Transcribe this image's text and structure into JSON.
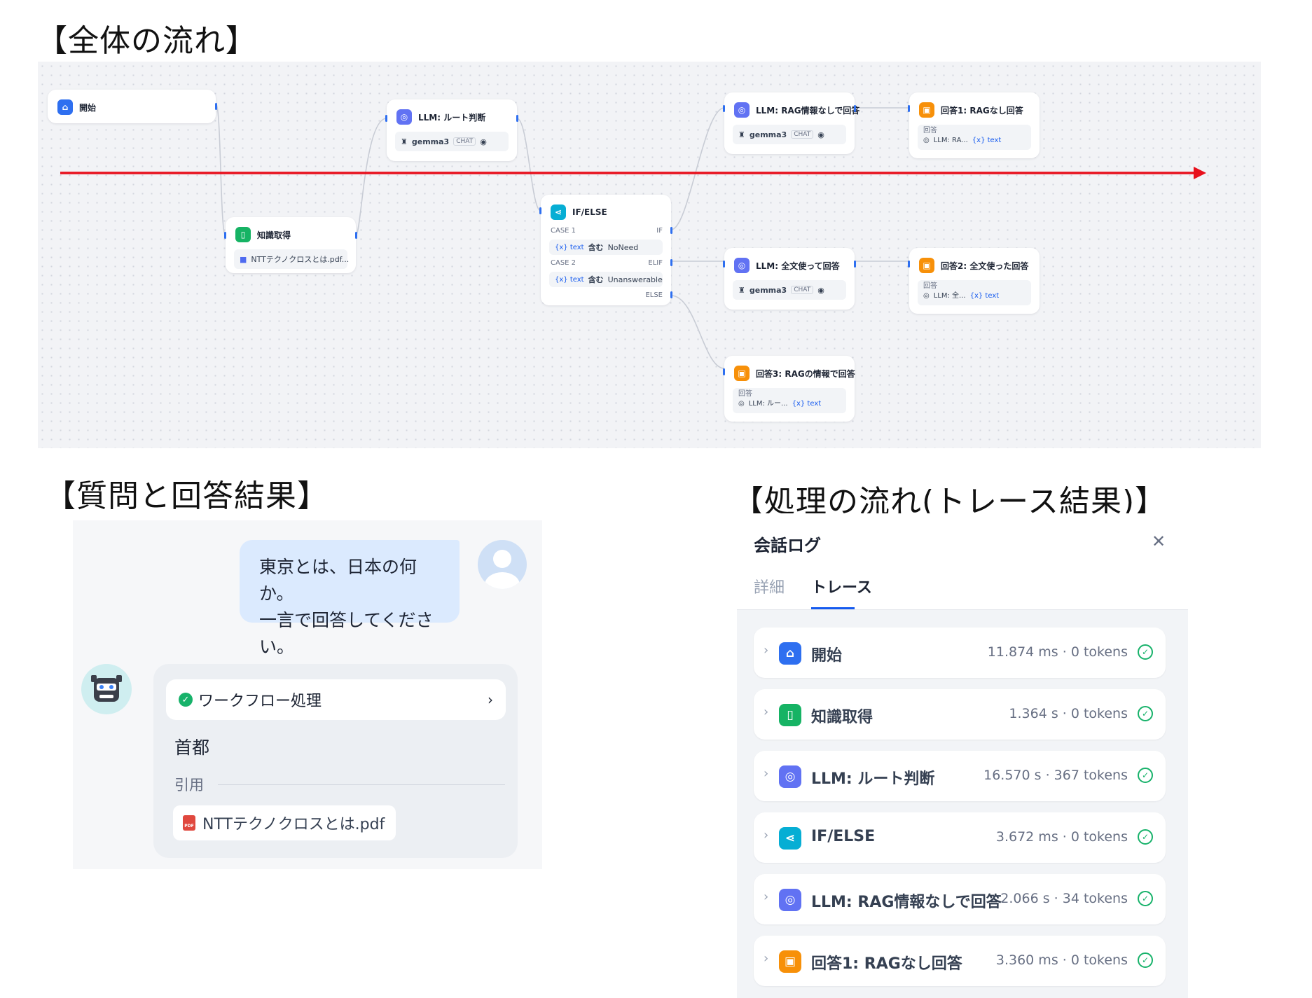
{
  "headings": {
    "overall_flow": "【全体の流れ】",
    "qa_result": "【質問と回答結果】",
    "process_flow": "【処理の流れ(トレース結果)】"
  },
  "workflow": {
    "start": {
      "title": "開始",
      "icon": "home-icon"
    },
    "knowledge": {
      "title": "知識取得",
      "file": "NTTテクノクロスとは.pdf...",
      "icon": "book-icon"
    },
    "llm_route": {
      "title": "LLM: ルート判断",
      "model": "gemma3",
      "tag": "CHAT"
    },
    "ifelse": {
      "title": "IF/ELSE",
      "case1": "CASE 1",
      "if": "IF",
      "cond1_var": "{x} text",
      "cond1_op": "含む",
      "cond1_val": "NoNeed",
      "case2": "CASE 2",
      "elif": "ELIF",
      "cond2_var": "{x} text",
      "cond2_op": "含む",
      "cond2_val": "Unanswerable",
      "else": "ELSE"
    },
    "llm_norag": {
      "title": "LLM: RAG情報なしで回答",
      "model": "gemma3",
      "tag": "CHAT"
    },
    "llm_full": {
      "title": "LLM: 全文使って回答",
      "model": "gemma3",
      "tag": "CHAT"
    },
    "ans1": {
      "title": "回答1: RAGなし回答",
      "label": "回答",
      "src": "LLM: RA...",
      "var": "{x} text"
    },
    "ans2": {
      "title": "回答2: 全文使った回答",
      "label": "回答",
      "src": "LLM: 全...",
      "var": "{x} text"
    },
    "ans3": {
      "title": "回答3: RAGの情報で回答",
      "label": "回答",
      "src": "LLM: ルー...",
      "var": "{x} text"
    },
    "arrow_color": "#e8101c"
  },
  "chat": {
    "user_message_line1": "東京とは、日本の何か。",
    "user_message_line2": "一言で回答してください。",
    "workflow_label": "ワークフロー処理",
    "answer": "首都",
    "citation_label": "引用",
    "citation_file": "NTTテクノクロスとは.pdf"
  },
  "trace_panel": {
    "title": "会話ログ",
    "tabs": [
      "詳細",
      "トレース"
    ],
    "active_tab": "トレース",
    "rows": [
      {
        "name": "開始",
        "stat": "11.874 ms · 0 tokens",
        "icon": "home-icon",
        "color": "#2e6ff0"
      },
      {
        "name": "知識取得",
        "stat": "1.364 s · 0 tokens",
        "icon": "book-icon",
        "color": "#16b364"
      },
      {
        "name": "LLM: ルート判断",
        "stat": "16.570 s · 367 tokens",
        "icon": "llm-icon",
        "color": "#6172f3"
      },
      {
        "name": "IF/ELSE",
        "stat": "3.672 ms · 0 tokens",
        "icon": "branch-icon",
        "color": "#06aed4"
      },
      {
        "name": "LLM: RAG情報なしで回答",
        "stat": "2.066 s · 34 tokens",
        "icon": "llm-icon",
        "color": "#6172f3"
      },
      {
        "name": "回答1: RAGなし回答",
        "stat": "3.360 ms · 0 tokens",
        "icon": "answer-icon",
        "color": "#f79009"
      }
    ]
  }
}
